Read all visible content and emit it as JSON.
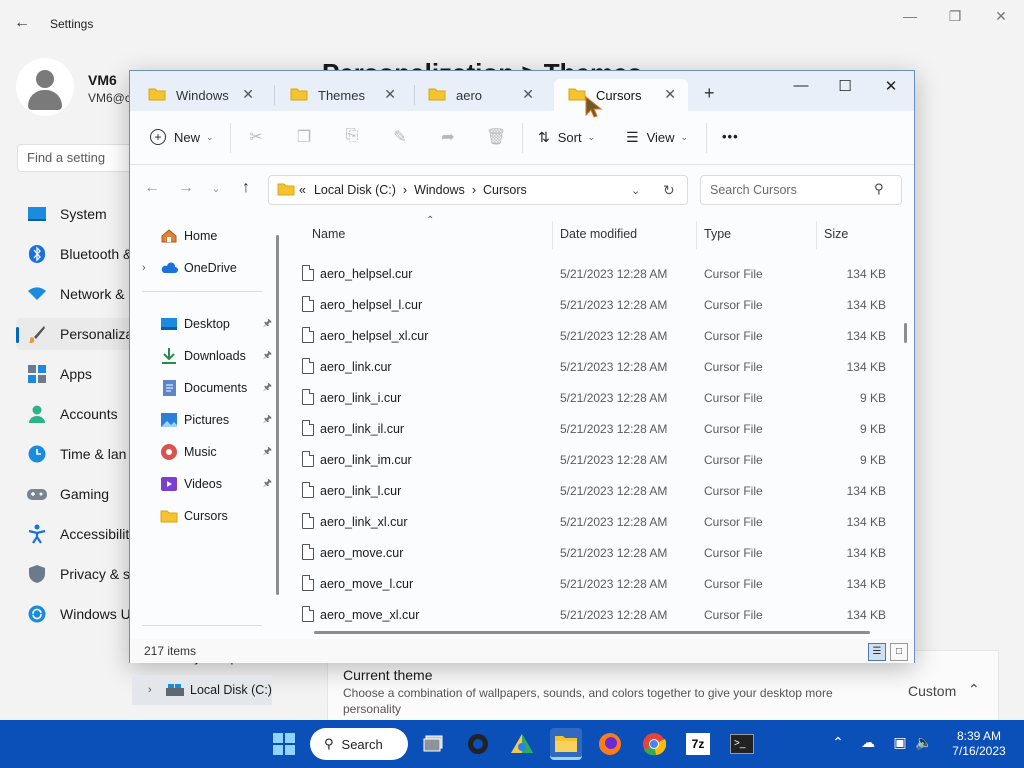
{
  "settings": {
    "window_title": "Settings",
    "user_name": "VM6",
    "user_email": "VM6@c",
    "search_placeholder": "Find a setting",
    "page_heading": "Personalization > Themes",
    "nav": [
      {
        "label": "System",
        "icon": "monitor-icon"
      },
      {
        "label": "Bluetooth &",
        "icon": "bluetooth-icon"
      },
      {
        "label": "Network &",
        "icon": "wifi-icon"
      },
      {
        "label": "Personaliza",
        "icon": "brush-icon",
        "active": true
      },
      {
        "label": "Apps",
        "icon": "apps-icon"
      },
      {
        "label": "Accounts",
        "icon": "person-icon"
      },
      {
        "label": "Time & lan",
        "icon": "clock-icon"
      },
      {
        "label": "Gaming",
        "icon": "gamepad-icon"
      },
      {
        "label": "Accessibilit",
        "icon": "accessibility-icon"
      },
      {
        "label": "Privacy & s",
        "icon": "shield-icon"
      },
      {
        "label": "Windows U",
        "icon": "update-icon"
      }
    ],
    "current_theme": {
      "title": "Current theme",
      "description": "Choose a combination of wallpapers, sounds, and colors together to give your desktop more personality",
      "value": "Custom"
    }
  },
  "explorer": {
    "tabs": [
      "Windows",
      "Themes",
      "aero",
      "Cursors"
    ],
    "active_tab": "Cursors",
    "toolbar": {
      "new_label": "New",
      "sort_label": "Sort",
      "view_label": "View",
      "more_label": "•••"
    },
    "address": {
      "prefix": "«",
      "parts": [
        "Local Disk (C:)",
        "Windows",
        "Cursors"
      ]
    },
    "search_placeholder": "Search Cursors",
    "nav_pane": {
      "top": [
        {
          "label": "Home",
          "icon": "home-icon"
        },
        {
          "label": "OneDrive",
          "icon": "cloud-icon"
        }
      ],
      "quick": [
        {
          "label": "Desktop",
          "icon": "desktop-icon",
          "pinned": true
        },
        {
          "label": "Downloads",
          "icon": "download-icon",
          "pinned": true
        },
        {
          "label": "Documents",
          "icon": "document-icon",
          "pinned": true
        },
        {
          "label": "Pictures",
          "icon": "pictures-icon",
          "pinned": true
        },
        {
          "label": "Music",
          "icon": "music-icon",
          "pinned": true
        },
        {
          "label": "Videos",
          "icon": "videos-icon",
          "pinned": true
        },
        {
          "label": "Cursors",
          "icon": "folder-icon",
          "pinned": false
        }
      ],
      "computer": [
        {
          "label": "My Computer",
          "icon": "computer-icon"
        },
        {
          "label": "Local Disk (C:)",
          "icon": "drive-icon"
        }
      ]
    },
    "columns": [
      "Name",
      "Date modified",
      "Type",
      "Size"
    ],
    "files": [
      {
        "name": "aero_helpsel.cur",
        "date": "5/21/2023 12:28 AM",
        "type": "Cursor File",
        "size": "134 KB"
      },
      {
        "name": "aero_helpsel_l.cur",
        "date": "5/21/2023 12:28 AM",
        "type": "Cursor File",
        "size": "134 KB"
      },
      {
        "name": "aero_helpsel_xl.cur",
        "date": "5/21/2023 12:28 AM",
        "type": "Cursor File",
        "size": "134 KB"
      },
      {
        "name": "aero_link.cur",
        "date": "5/21/2023 12:28 AM",
        "type": "Cursor File",
        "size": "134 KB"
      },
      {
        "name": "aero_link_i.cur",
        "date": "5/21/2023 12:28 AM",
        "type": "Cursor File",
        "size": "9 KB"
      },
      {
        "name": "aero_link_il.cur",
        "date": "5/21/2023 12:28 AM",
        "type": "Cursor File",
        "size": "9 KB"
      },
      {
        "name": "aero_link_im.cur",
        "date": "5/21/2023 12:28 AM",
        "type": "Cursor File",
        "size": "9 KB"
      },
      {
        "name": "aero_link_l.cur",
        "date": "5/21/2023 12:28 AM",
        "type": "Cursor File",
        "size": "134 KB"
      },
      {
        "name": "aero_link_xl.cur",
        "date": "5/21/2023 12:28 AM",
        "type": "Cursor File",
        "size": "134 KB"
      },
      {
        "name": "aero_move.cur",
        "date": "5/21/2023 12:28 AM",
        "type": "Cursor File",
        "size": "134 KB"
      },
      {
        "name": "aero_move_l.cur",
        "date": "5/21/2023 12:28 AM",
        "type": "Cursor File",
        "size": "134 KB"
      },
      {
        "name": "aero_move_xl.cur",
        "date": "5/21/2023 12:28 AM",
        "type": "Cursor File",
        "size": "134 KB"
      }
    ],
    "status": "217 items"
  },
  "taskbar": {
    "search_label": "Search",
    "apps": [
      "start-icon",
      "task-view-icon",
      "settings-app-icon",
      "paint-app-icon",
      "file-explorer-icon",
      "firefox-icon",
      "chrome-icon",
      "7zip-icon",
      "terminal-icon"
    ],
    "time": "8:39 AM",
    "date": "7/16/2023"
  },
  "colors": {
    "accent": "#0067c0",
    "taskbar": "#0b4fb8",
    "folder": "#f4c430"
  }
}
